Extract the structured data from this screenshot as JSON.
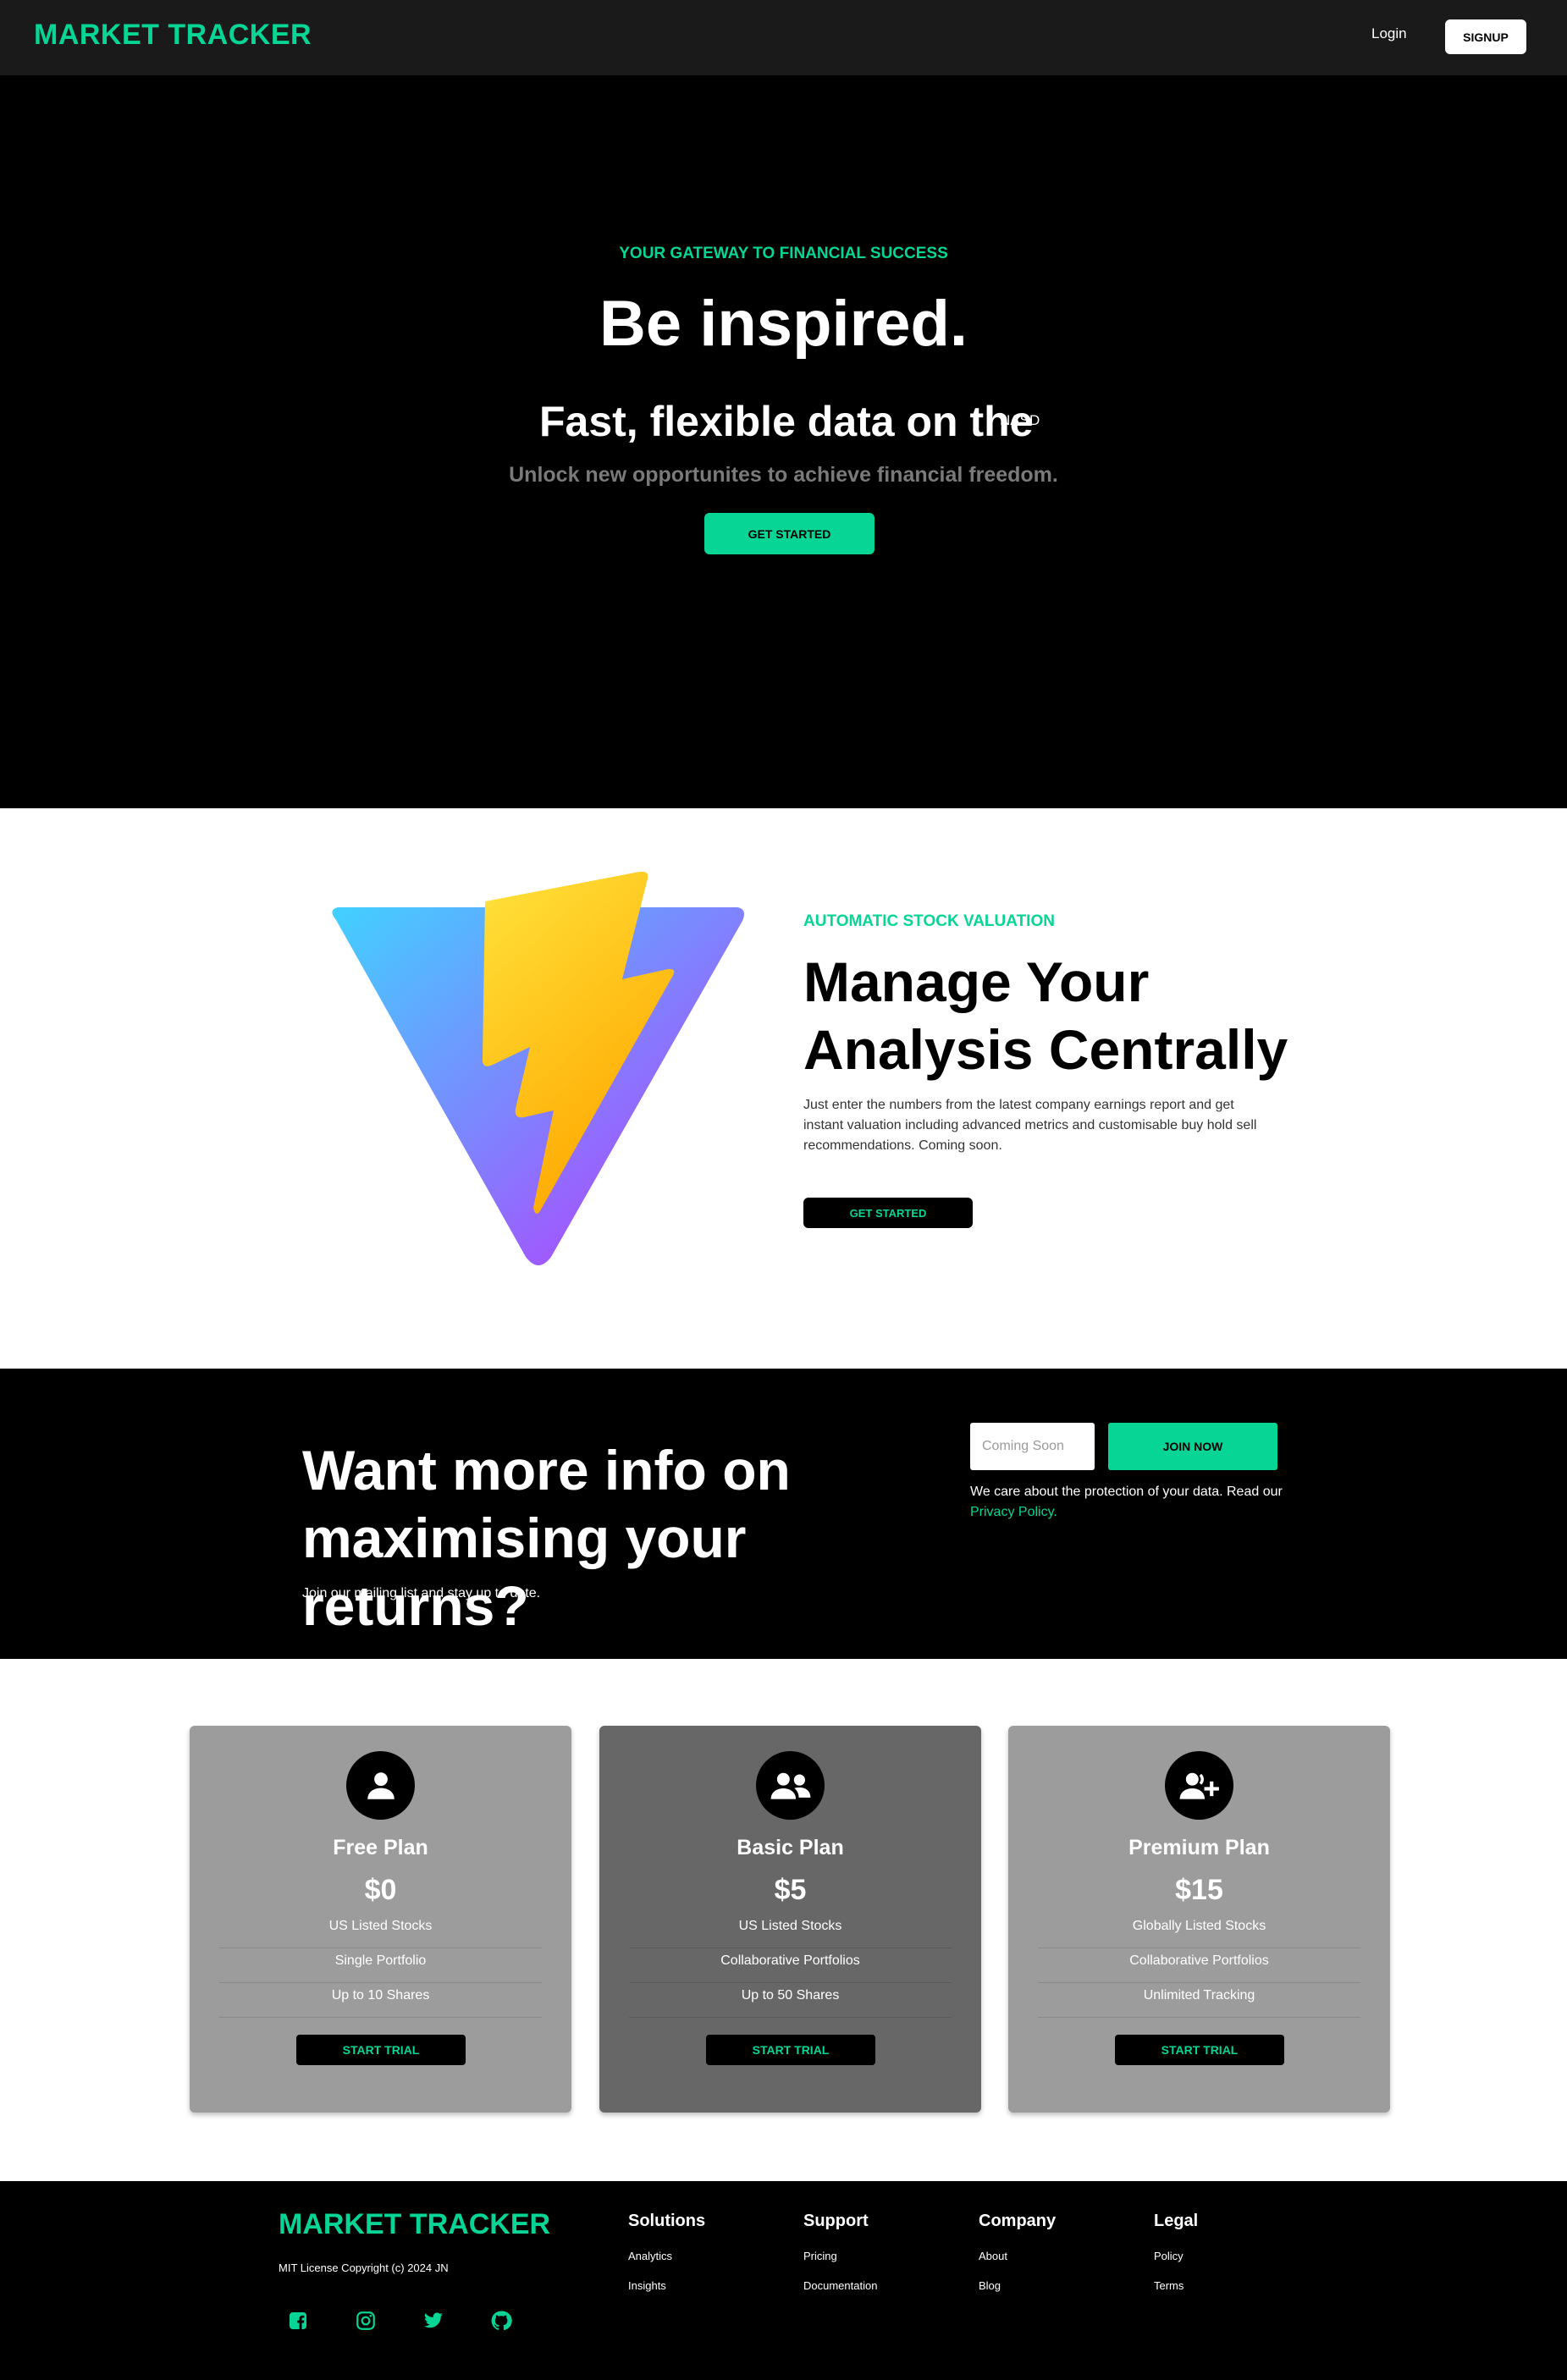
{
  "nav": {
    "brand": "MARKET TRACKER",
    "login_label": "Login",
    "signup_label": "SIGNUP"
  },
  "hero": {
    "eyebrow": "YOUR GATEWAY TO FINANCIAL SUCCESS",
    "title": "Be inspired.",
    "subtitle": "Fast, flexible data on the",
    "ticker": "NASD",
    "lead": "Unlock new opportunites to achieve financial freedom.",
    "cta_label": "GET STARTED"
  },
  "feature": {
    "logo_icon": "vite-lightning-logo",
    "eyebrow": "AUTOMATIC STOCK VALUATION",
    "title_line1": "Manage Your",
    "title_line2": "Analysis Centrally",
    "body": "Just enter the numbers from the latest company earnings report and get instant valuation including advanced metrics and customisable buy hold sell recommendations. Coming soon.",
    "cta_label": "GET STARTED"
  },
  "newsletter": {
    "title_line1": "Want more info on",
    "title_line2": "maximising your returns?",
    "subtitle": "Join our mailing list and stay up to date.",
    "input_value": "",
    "input_placeholder": "Coming Soon",
    "join_label": "JOIN NOW",
    "privacy_text": "We care about the protection of your data. Read our",
    "privacy_link": "Privacy Policy."
  },
  "pricing": {
    "plans": [
      {
        "icon": "user-icon",
        "name": "Free Plan",
        "price": "$0",
        "features": [
          "US Listed Stocks",
          "Single Portfolio",
          "Up to 10 Shares"
        ],
        "cta_label": "START TRIAL"
      },
      {
        "icon": "users-icon",
        "name": "Basic Plan",
        "price": "$5",
        "features": [
          "US Listed Stocks",
          "Collaborative Portfolios",
          "Up to 50 Shares"
        ],
        "cta_label": "START TRIAL"
      },
      {
        "icon": "user-plus-icon",
        "name": "Premium Plan",
        "price": "$15",
        "features": [
          "Globally Listed Stocks",
          "Collaborative Portfolios",
          "Unlimited Tracking"
        ],
        "cta_label": "START TRIAL"
      }
    ]
  },
  "footer": {
    "brand": "MARKET TRACKER",
    "license": "MIT License Copyright (c) 2024 JN",
    "social_icons": [
      "facebook-icon",
      "instagram-icon",
      "twitter-icon",
      "github-icon"
    ],
    "columns": [
      {
        "title": "Solutions",
        "links": [
          "Analytics",
          "Insights"
        ]
      },
      {
        "title": "Support",
        "links": [
          "Pricing",
          "Documentation"
        ]
      },
      {
        "title": "Company",
        "links": [
          "About",
          "Blog"
        ]
      },
      {
        "title": "Legal",
        "links": [
          "Policy",
          "Terms"
        ]
      }
    ]
  },
  "colors": {
    "accent": "#06d595",
    "dark": "#000000",
    "nav_bg": "#1a1a1a",
    "card_light": "#9c9c9c",
    "card_dark": "#676767"
  }
}
